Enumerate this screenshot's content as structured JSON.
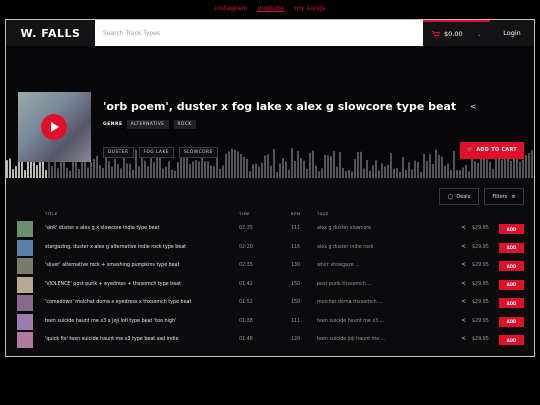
{
  "toplinks": {
    "instagram": "instagram",
    "youtube": "youtube",
    "mysongs": "my songs"
  },
  "header": {
    "logo": "W. FALLS",
    "search_placeholder": "Search Track Types",
    "cart_total": "$0.00",
    "login": "Login"
  },
  "hero": {
    "title": "'orb poem', duster x fog lake x alex g slowcore type beat",
    "genre_label": "GENRE",
    "genres": [
      "ALTERNATIVE",
      "ROCK"
    ],
    "tags": [
      "DUSTER",
      "FOG LAKE",
      "SLOWCORE"
    ],
    "add_to_cart": "ADD TO CART"
  },
  "controls": {
    "deals": "Deals",
    "filters": "Filters"
  },
  "table": {
    "headers": {
      "title": "TITLE",
      "time": "TIME",
      "bpm": "BPM",
      "tags": "TAGS"
    },
    "add_label": "ADD",
    "rows": [
      {
        "title": "'sink' duster x alex g x slowcore indie type beat",
        "time": "02:35",
        "bpm": "111",
        "tags": "alex g  duster  slowcore",
        "price": "$29.95"
      },
      {
        "title": "stargazing, duster x alex g alternative indie rock type beat",
        "time": "02:20",
        "bpm": "116",
        "tags": "alex g  duster  indie rock",
        "price": "$29.95"
      },
      {
        "title": "'silver' alternative rock + smashing pumpkins type beat",
        "time": "02:35",
        "bpm": "130",
        "tags": "whirr  shoegaze  ...",
        "price": "$29.95"
      },
      {
        "title": "'VIOLENCE' post punk + eyedress + thxsomch type beat",
        "time": "01:42",
        "bpm": "150",
        "tags": "post punk  thxsomch  ...",
        "price": "$29.95"
      },
      {
        "title": "'comedown' molchat doma x eyedress x thxsomch type beat",
        "time": "01:52",
        "bpm": "150",
        "tags": "molchat doma  thxsomch  ...",
        "price": "$29.95"
      },
      {
        "title": "teen suicide haunt me x3 x joji lofi type beat 'too high'",
        "time": "01:38",
        "bpm": "111",
        "tags": "teen suicide  haunt me x3  ...",
        "price": "$29.95"
      },
      {
        "title": "'quick fix' teen suicide haunt me x3 type beat sad indie",
        "time": "01:48",
        "bpm": "120",
        "tags": "teen suicide  joji  haunt me ...",
        "price": "$29.95"
      }
    ]
  },
  "colors": {
    "accent": "#e0102a",
    "background": "#0b0b0e"
  }
}
